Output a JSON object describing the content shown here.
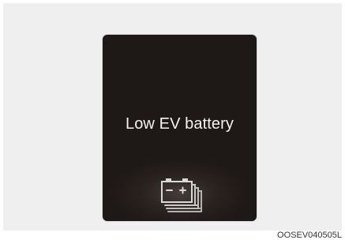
{
  "warning_display": {
    "message": "Low EV battery",
    "icon": "stacked-battery-icon"
  },
  "figure": {
    "caption": "OOSEV040505L"
  },
  "colors": {
    "background": "#efefef",
    "screen": "#1e1816",
    "text": "#f4f4f4",
    "icon": "#d9d9d9"
  }
}
